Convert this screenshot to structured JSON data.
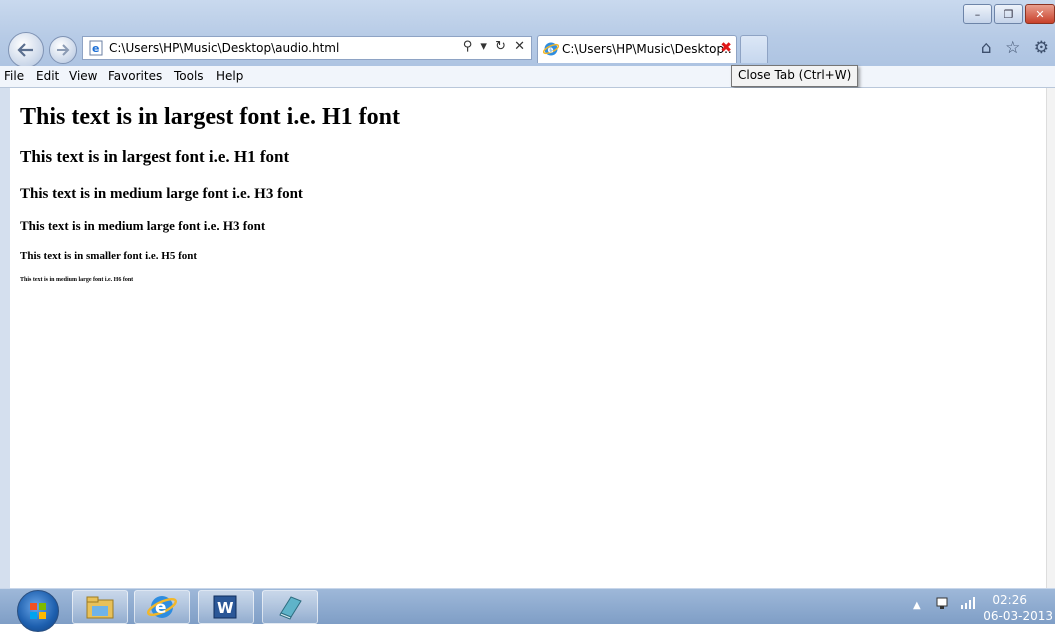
{
  "window": {
    "controls": {
      "minimize": "–",
      "restore": "❐",
      "close": "✕"
    }
  },
  "toolbar": {
    "back_icon": "back-arrow-icon",
    "forward_icon": "forward-arrow-icon",
    "address_url": "C:\\Users\\HP\\Music\\Desktop\\audio.html",
    "address_actions": "⚲ ▾ ↻ ✕",
    "right_icons": "⌂ ☆ ⚙"
  },
  "tabs": {
    "active_title": "C:\\Users\\HP\\Music\\Desktop..",
    "close_glyph": "✖"
  },
  "tooltip": "Close Tab (Ctrl+W)",
  "menu": {
    "items": [
      "File",
      "Edit",
      "View",
      "Favorites",
      "Tools",
      "Help"
    ]
  },
  "page": {
    "h1": "This text is in largest font i.e. H1 font",
    "h2": "This text is in largest font i.e. H1 font",
    "h3a": "This text is in medium large font i.e. H3 font",
    "h3b": "This text is in medium large font i.e. H3 font",
    "h5": "This text is in smaller font i.e. H5 font",
    "h6": "This text is in medium large font i.e. H6 font"
  },
  "taskbar": {
    "tray_up": "▲",
    "clock_time": "02:26",
    "clock_date": "06-03-2013"
  },
  "colors": {
    "chrome": "#b7cbe6",
    "taskbar": "#8aa8cf",
    "tab_close": "#e01818"
  }
}
